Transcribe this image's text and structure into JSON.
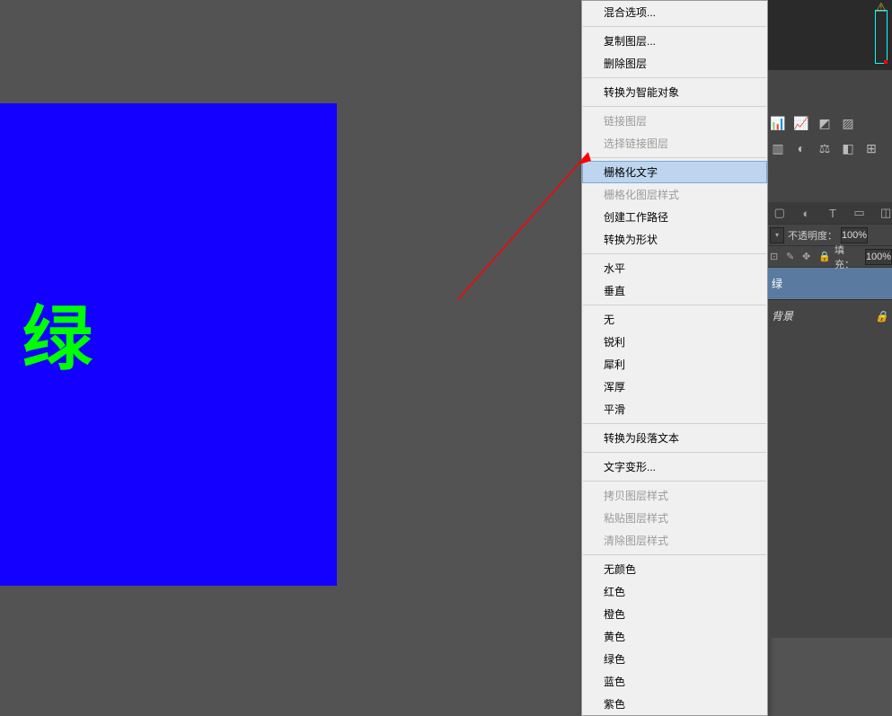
{
  "canvas": {
    "text": "绿"
  },
  "menu": {
    "blending": "混合选项...",
    "dup": "复制图层...",
    "del": "删除图层",
    "smart": "转换为智能对象",
    "linklayer": "链接图层",
    "sellinked": "选择链接图层",
    "rasterize_text": "栅格化文字",
    "rasterize_style": "栅格化图层样式",
    "workpath": "创建工作路径",
    "toshape": "转换为形状",
    "horiz": "水平",
    "vert": "垂直",
    "none": "无",
    "sharp": "锐利",
    "crisp": "犀利",
    "strong": "浑厚",
    "smooth": "平滑",
    "paratext": "转换为段落文本",
    "warp": "文字变形...",
    "copystyle": "拷贝图层样式",
    "pastestyle": "粘贴图层样式",
    "clearstyle": "清除图层样式",
    "nocolor": "无颜色",
    "red": "红色",
    "orange": "橙色",
    "yellow": "黄色",
    "green": "绿色",
    "blue": "蓝色",
    "purple": "紫色"
  },
  "panel": {
    "opacity_label": "不透明度：",
    "opacity_val": "100%",
    "fill_label": "填充：",
    "fill_val": "100%",
    "layer_text": "绿",
    "layer_bg": "背景"
  }
}
